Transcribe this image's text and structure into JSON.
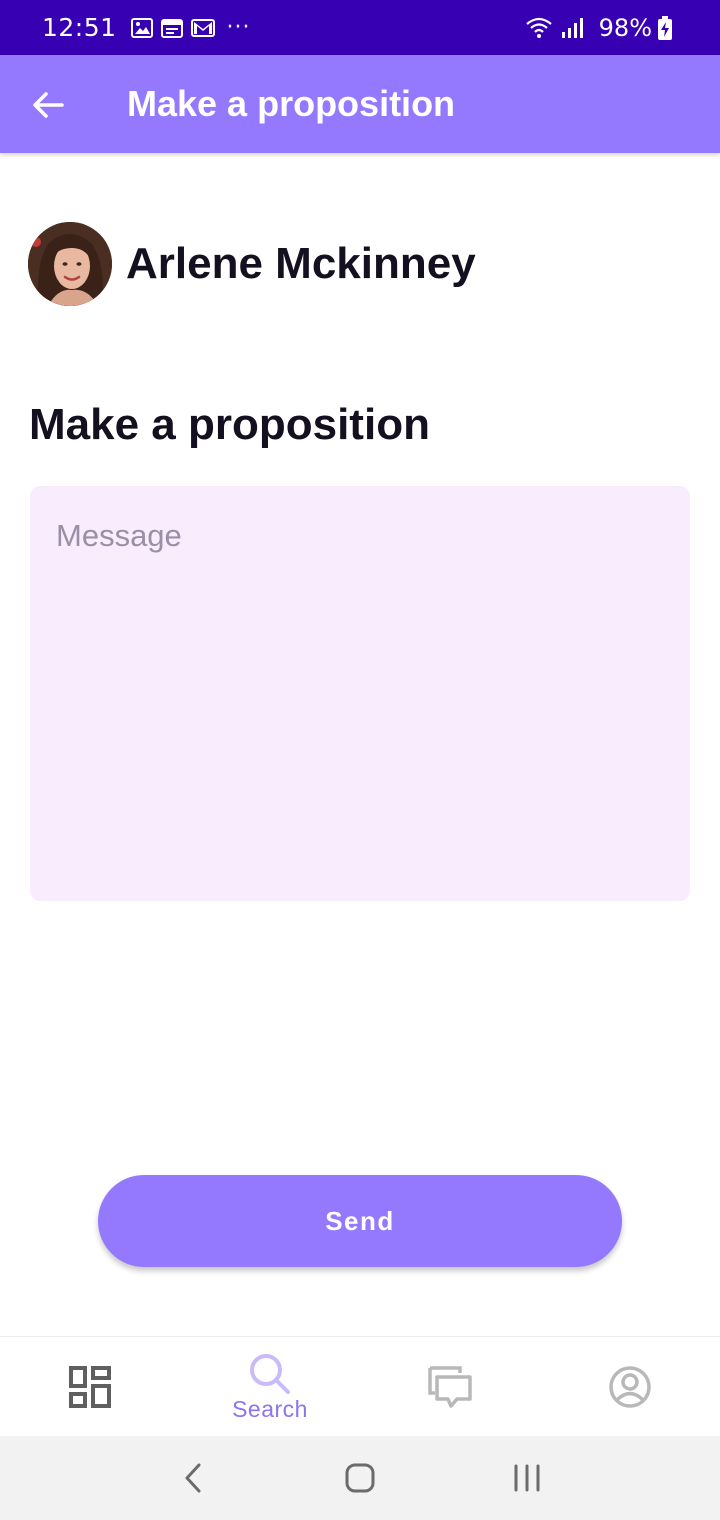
{
  "status_bar": {
    "time": "12:51",
    "battery": "98%",
    "more_indicator": "···",
    "icons": [
      "image-icon",
      "calendar-icon",
      "gmail-icon",
      "wifi-icon",
      "signal-icon",
      "battery-charging-icon"
    ]
  },
  "app_bar": {
    "title": "Make a proposition",
    "back_icon": "arrow-back-icon",
    "background": "#9479ff"
  },
  "profile": {
    "name": "Arlene Mckinney"
  },
  "section": {
    "title": "Make a proposition"
  },
  "message": {
    "placeholder": "Message",
    "value": ""
  },
  "actions": {
    "send_label": "Send"
  },
  "bottom_nav": {
    "items": [
      {
        "icon": "dashboard-icon",
        "label": "",
        "active": false
      },
      {
        "icon": "search-icon",
        "label": "Search",
        "active": true
      },
      {
        "icon": "chat-icon",
        "label": "",
        "active": false
      },
      {
        "icon": "account-icon",
        "label": "",
        "active": false
      }
    ]
  },
  "system_nav": {
    "icons": [
      "back-icon",
      "home-icon",
      "recents-icon"
    ]
  },
  "colors": {
    "status_bar": "#3700b3",
    "accent": "#9479ff",
    "message_bg": "#f9ecfd",
    "text_dark": "#14101f",
    "active_nav": "#8c73f2"
  }
}
